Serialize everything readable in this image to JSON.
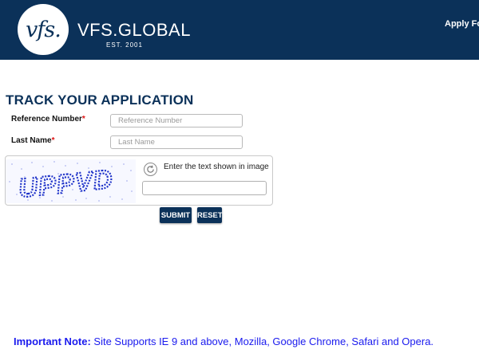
{
  "header": {
    "logo_text": "vfs.",
    "brand": "VFS.GLOBAL",
    "est": "EST. 2001",
    "apply_link": "Apply Fo"
  },
  "page": {
    "title": "TRACK YOUR APPLICATION"
  },
  "form": {
    "reference_label": "Reference Number",
    "reference_placeholder": "Reference Number",
    "lastname_label": "Last Name",
    "lastname_placeholder": "Last Name",
    "required_mark": "*",
    "captcha_text": "UPPVD",
    "captcha_label": "Enter the text shown in image",
    "submit_label": "SUBMIT",
    "reset_label": "RESET"
  },
  "note": {
    "heading": "Important Note:",
    "text": "Site Supports IE 9 and above, Mozilla, Google Chrome, Safari and Opera."
  },
  "colors": {
    "brand_navy": "#0b3159",
    "note_blue": "#1a1aee",
    "required_red": "#dd1111"
  },
  "icons": [
    "refresh-icon"
  ]
}
